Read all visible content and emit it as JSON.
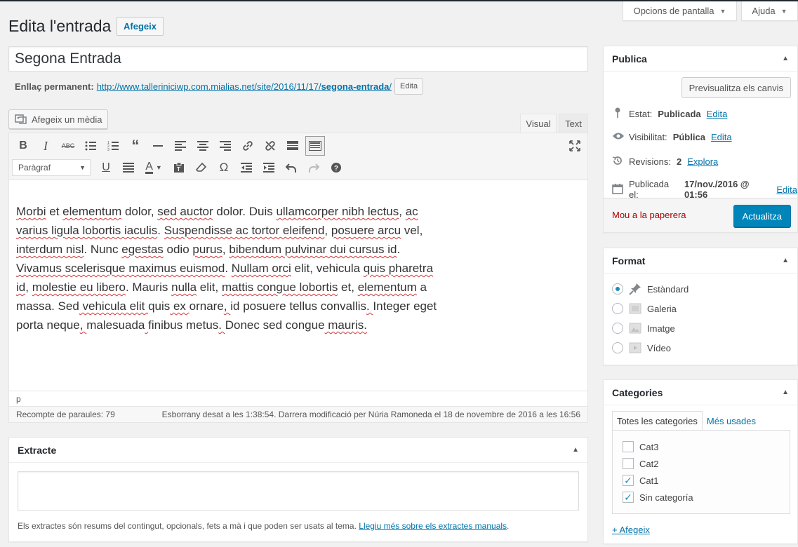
{
  "screen_meta": {
    "options_label": "Opcions de pantalla",
    "help_label": "Ajuda"
  },
  "header": {
    "title": "Edita l'entrada",
    "add_new_label": "Afegeix"
  },
  "post": {
    "title": "Segona Entrada",
    "permalink_label": "Enllaç permanent:",
    "permalink_url": "http://www.talleriniciwp.com.mialias.net/site/2016/11/17/",
    "permalink_slug": "segona-entrada",
    "permalink_slash": "/",
    "edit_permalink_label": "Edita"
  },
  "editor": {
    "add_media_label": "Afegeix un mèdia",
    "tabs": {
      "visual": "Visual",
      "text": "Text"
    },
    "format_select": "Paràgraf",
    "path": "p",
    "word_count": "Recompte de paraules: 79",
    "autosave": "Esborrany desat a les 1:38:54. Darrera modificació per Núria Ramoneda el 18 de novembre de 2016 a les 16:56",
    "content": "Morbi et elementum dolor, sed auctor dolor. Duis ullamcorper nibh lectus, ac varius ligula lobortis iaculis. Suspendisse ac tortor eleifend, posuere arcu vel, interdum nisl. Nunc egestas odio purus, bibendum pulvinar dui cursus id. Vivamus scelerisque maximus euismod. Nullam orci elit, vehicula quis pharetra id, molestie eu libero. Mauris nulla elit, mattis congue lobortis et, elementum a massa. Sed vehicula elit quis ex ornare, id posuere tellus convallis. Integer eget porta neque, malesuada finibus metus. Donec sed congue mauris.",
    "content_lines": [
      [
        "Morbi",
        " et ",
        "elementum",
        " dolor, ",
        "sed auctor",
        " dolor. Duis ",
        "ullamcorper nibh lectus",
        ", ",
        "ac"
      ],
      [
        "varius ligula lobortis iaculis",
        ". ",
        "Suspendisse ac tortor eleifend",
        ", ",
        "posuere arcu",
        " vel,"
      ],
      [
        "interdum nisl",
        ". Nunc ",
        "egestas",
        " odio ",
        "purus",
        ", ",
        "bibendum pulvinar dui cursus id",
        "."
      ],
      [
        "Vivamus scelerisque maximus euismod",
        ". ",
        "Nullam orci",
        " elit, vehicula ",
        "quis pharetra"
      ],
      [
        "id",
        ", ",
        "molestie eu libero",
        ". Mauris ",
        "nulla",
        " elit, ",
        "mattis congue lobortis",
        " et, ",
        "elementum",
        " a"
      ],
      [
        "massa. ",
        "Sed",
        " vehicula elit ",
        "quis",
        " ex ",
        "ornare",
        ", ",
        "id posuere tellus convallis",
        ". ",
        "Integer eget"
      ],
      [
        "porta ",
        "neque",
        ", ",
        "malesuada",
        " ",
        "finibus metus",
        ". ",
        "Donec sed congue",
        " mauris."
      ]
    ]
  },
  "excerpt": {
    "title": "Extracte",
    "help_text": "Els extractes són resums del contingut, opcionals, fets a mà i que poden ser usats al tema.",
    "help_link": "Llegiu més sobre els extractes manuals"
  },
  "publish": {
    "title": "Publica",
    "preview_label": "Previsualitza els canvis",
    "status_label": "Estat:",
    "status_value": "Publicada",
    "visibility_label": "Visibilitat:",
    "visibility_value": "Pública",
    "revisions_label": "Revisions:",
    "revisions_value": "2",
    "revisions_link": "Explora",
    "published_label": "Publicada el:",
    "published_value": "17/nov./2016 @ 01:56",
    "edit_link": "Edita",
    "trash_label": "Mou a la paperera",
    "update_label": "Actualitza"
  },
  "format": {
    "title": "Format",
    "options": [
      {
        "label": "Estàndard",
        "icon": "pin-icon",
        "checked": true
      },
      {
        "label": "Galeria",
        "icon": "gallery-icon",
        "checked": false
      },
      {
        "label": "Imatge",
        "icon": "image-icon",
        "checked": false
      },
      {
        "label": "Vídeo",
        "icon": "video-icon",
        "checked": false
      }
    ]
  },
  "categories": {
    "title": "Categories",
    "tab_all": "Totes les categories",
    "tab_used": "Més usades",
    "items": [
      {
        "label": "Cat3",
        "checked": false
      },
      {
        "label": "Cat2",
        "checked": false
      },
      {
        "label": "Cat1",
        "checked": true
      },
      {
        "label": "Sin categoría",
        "checked": true
      }
    ],
    "add_label": "+ Afegeix"
  },
  "colors": {
    "primary": "#0085ba",
    "link": "#0073aa",
    "danger": "#a00",
    "spell": "#d63638"
  }
}
